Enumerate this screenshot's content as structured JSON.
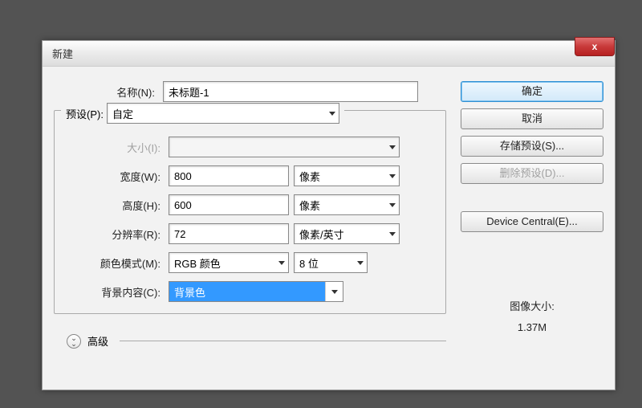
{
  "dialog": {
    "title": "新建",
    "close_icon": "x"
  },
  "name_row": {
    "label": "名称(N):",
    "value": "未标题-1"
  },
  "preset": {
    "legend_label": "预设(P):",
    "value": "自定",
    "size_label": "大小(I):",
    "size_value": "",
    "width_label": "宽度(W):",
    "width_value": "800",
    "width_unit": "像素",
    "height_label": "高度(H):",
    "height_value": "600",
    "height_unit": "像素",
    "resolution_label": "分辨率(R):",
    "resolution_value": "72",
    "resolution_unit": "像素/英寸",
    "color_mode_label": "颜色模式(M):",
    "color_mode_value": "RGB 颜色",
    "color_depth_value": "8 位",
    "background_label": "背景内容(C):",
    "background_value": "背景色"
  },
  "advanced": {
    "label": "高级"
  },
  "buttons": {
    "ok": "确定",
    "cancel": "取消",
    "save_preset": "存储预设(S)...",
    "delete_preset": "删除预设(D)...",
    "device_central": "Device Central(E)..."
  },
  "image_size": {
    "label": "图像大小:",
    "value": "1.37M"
  }
}
